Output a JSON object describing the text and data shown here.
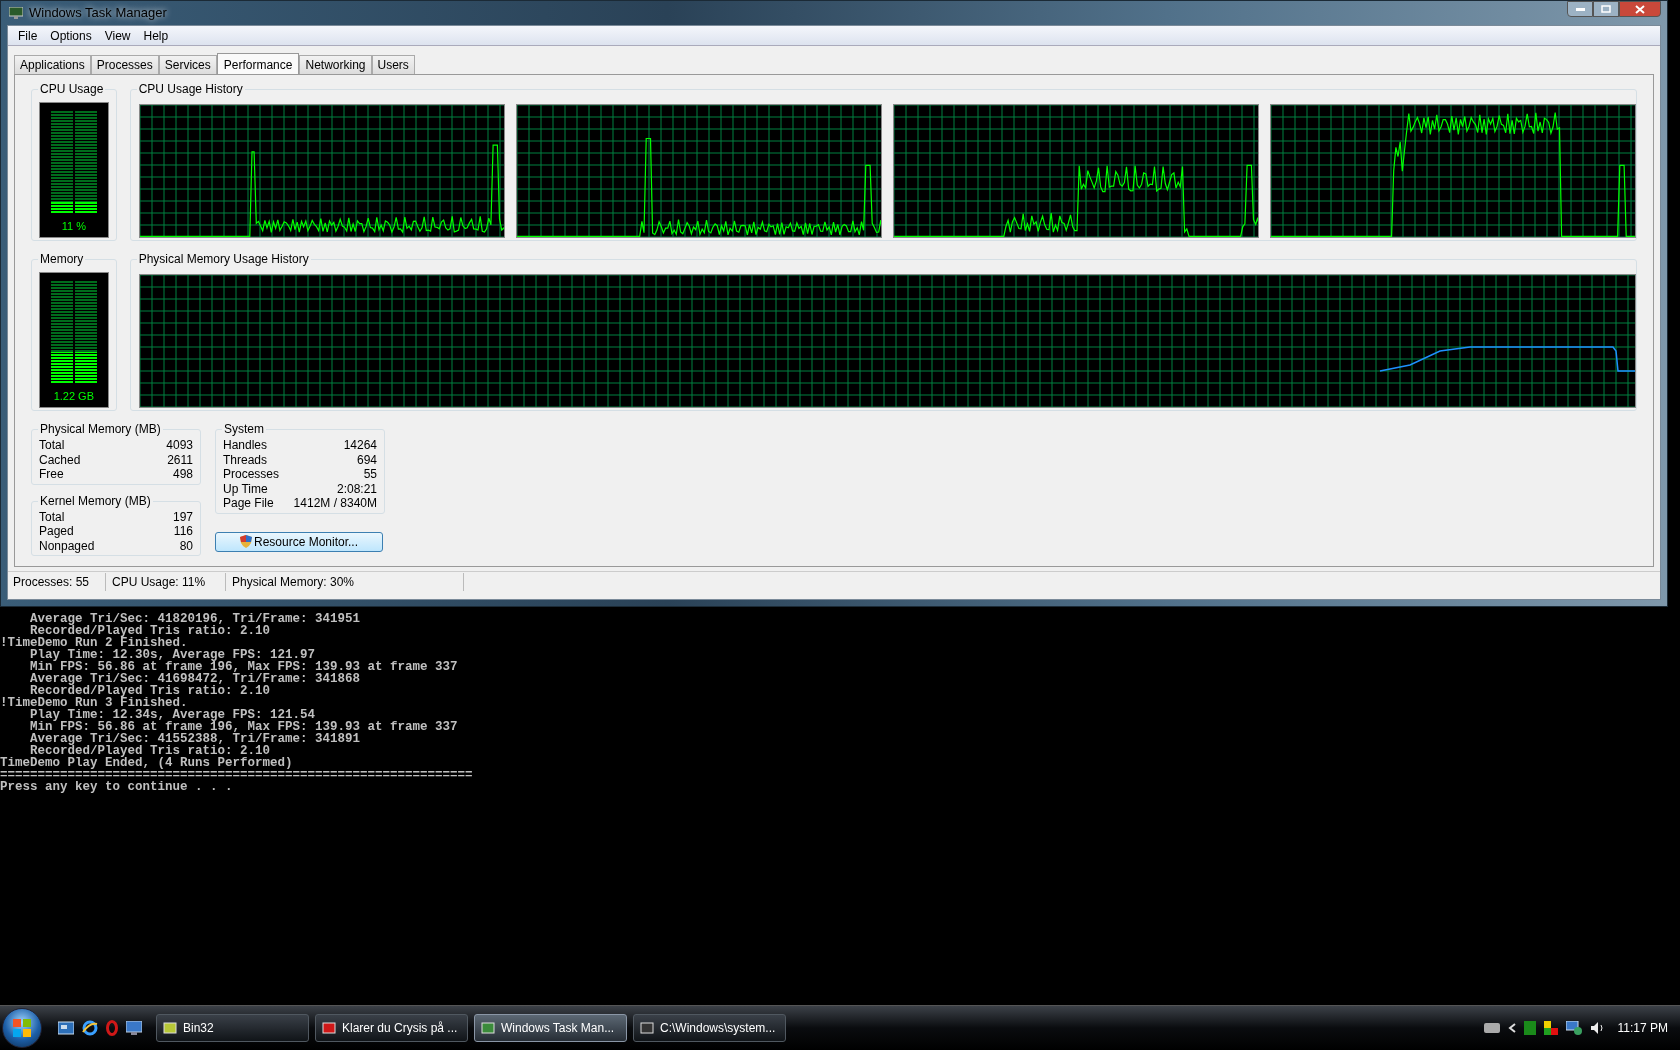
{
  "window": {
    "title": "Windows Task Manager"
  },
  "menu": [
    "File",
    "Options",
    "View",
    "Help"
  ],
  "tabs": [
    {
      "label": "Applications",
      "selected": false
    },
    {
      "label": "Processes",
      "selected": false
    },
    {
      "label": "Services",
      "selected": false
    },
    {
      "label": "Performance",
      "selected": true
    },
    {
      "label": "Networking",
      "selected": false
    },
    {
      "label": "Users",
      "selected": false
    }
  ],
  "cpu_usage": {
    "title": "CPU Usage",
    "reading": "11 %",
    "level": 0.11
  },
  "cpu_history": {
    "title": "CPU Usage History"
  },
  "memory": {
    "title": "Memory",
    "reading": "1.22 GB",
    "level": 0.3
  },
  "memory_history": {
    "title": "Physical Memory Usage History"
  },
  "physical_memory": {
    "title": "Physical Memory (MB)",
    "rows": [
      {
        "label": "Total",
        "value": "4093"
      },
      {
        "label": "Cached",
        "value": "2611"
      },
      {
        "label": "Free",
        "value": "498"
      }
    ]
  },
  "kernel_memory": {
    "title": "Kernel Memory (MB)",
    "rows": [
      {
        "label": "Total",
        "value": "197"
      },
      {
        "label": "Paged",
        "value": "116"
      },
      {
        "label": "Nonpaged",
        "value": "80"
      }
    ]
  },
  "system": {
    "title": "System",
    "rows": [
      {
        "label": "Handles",
        "value": "14264"
      },
      {
        "label": "Threads",
        "value": "694"
      },
      {
        "label": "Processes",
        "value": "55"
      },
      {
        "label": "Up Time",
        "value": "2:08:21"
      },
      {
        "label": "Page File",
        "value": "1412M / 8340M"
      }
    ]
  },
  "resource_monitor_button": "Resource Monitor...",
  "status_bar": [
    "Processes: 55",
    "CPU Usage: 11%",
    "Physical Memory: 30%"
  ],
  "console": {
    "lines": [
      "    Average Tri/Sec: 41820196, Tri/Frame: 341951",
      "    Recorded/Played Tris ratio: 2.10",
      "!TimeDemo Run 2 Finished.",
      "    Play Time: 12.30s, Average FPS: 121.97",
      "    Min FPS: 56.86 at frame 196, Max FPS: 139.93 at frame 337",
      "    Average Tri/Sec: 41698472, Tri/Frame: 341868",
      "    Recorded/Played Tris ratio: 2.10",
      "!TimeDemo Run 3 Finished.",
      "    Play Time: 12.34s, Average FPS: 121.54",
      "    Min FPS: 56.86 at frame 196, Max FPS: 139.93 at frame 337",
      "    Average Tri/Sec: 41552388, Tri/Frame: 341891",
      "    Recorded/Played Tris ratio: 2.10",
      "TimeDemo Play Ended, (4 Runs Performed)",
      "===============================================================",
      "Press any key to continue . . ."
    ]
  },
  "taskbar": {
    "windows": [
      {
        "label": "Bin32",
        "selected": false
      },
      {
        "label": "Klarer du Crysis på ...",
        "selected": false
      },
      {
        "label": "Windows Task Man...",
        "selected": true
      },
      {
        "label": "C:\\Windows\\system...",
        "selected": false
      }
    ],
    "clock": "11:17 PM"
  }
}
